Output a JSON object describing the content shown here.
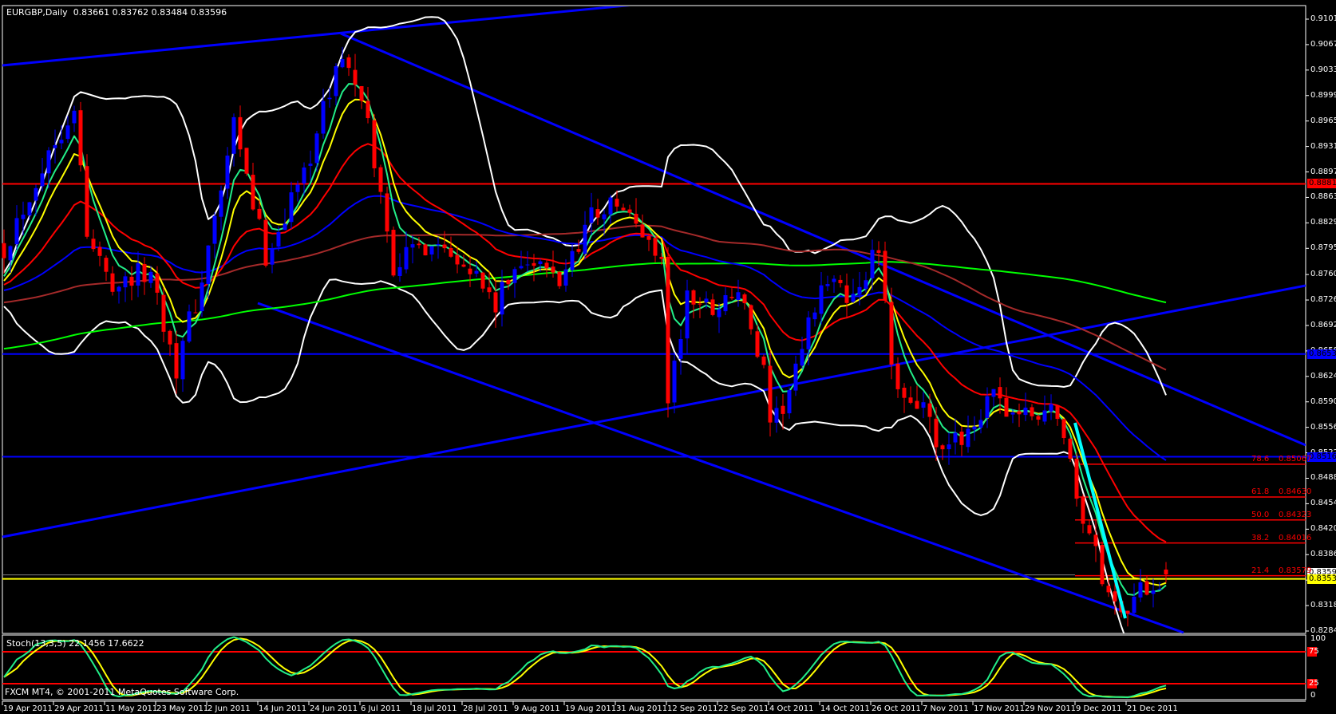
{
  "header": {
    "symbol_timeframe": "EURGBP,Daily",
    "ohlc": "0.83661 0.83762 0.83484 0.83596"
  },
  "indicator": {
    "stoch_label": "Stoch(13,3,5) 22.1456 17.6622",
    "scale_labels": [
      "100",
      "75",
      "25",
      "0"
    ]
  },
  "footer": {
    "copyright": "FXCM MT4, © 2001-2011 MetaQuotes Software Corp."
  },
  "colors": {
    "background": "#000000",
    "bull_candle": "#0000ff",
    "bear_candle": "#ff0000",
    "grid_text": "#ffffff"
  },
  "chart_data": {
    "type": "candlestick",
    "symbol": "EURGBP",
    "timeframe": "Daily",
    "bars": 183,
    "last_bar": {
      "open": 0.83661,
      "high": 0.83762,
      "low": 0.83484,
      "close": 0.83596
    },
    "price_axis": {
      "range": [
        0.8284,
        0.9101
      ],
      "ticks": [
        "0.91010",
        "0.90670",
        "0.90330",
        "0.89990",
        "0.89650",
        "0.89310",
        "0.88970",
        "0.88630",
        "0.88290",
        "0.87950",
        "0.87600",
        "0.87260",
        "0.86920",
        "0.86580",
        "0.86240",
        "0.85900",
        "0.85560",
        "0.85220",
        "0.84880",
        "0.84540",
        "0.84200",
        "0.83860",
        "0.83520",
        "0.83180",
        "0.82840"
      ]
    },
    "date_axis": {
      "bars_per_label": 8,
      "labels": [
        "19 Apr 2011",
        "29 Apr 2011",
        "11 May 2011",
        "23 May 2011",
        "2 Jun 2011",
        "14 Jun 2011",
        "24 Jun 2011",
        "6 Jul 2011",
        "18 Jul 2011",
        "28 Jul 2011",
        "9 Aug 2011",
        "19 Aug 2011",
        "31 Aug 2011",
        "12 Sep 2011",
        "22 Sep 2011",
        "4 Oct 2011",
        "14 Oct 2011",
        "26 Oct 2011",
        "7 Nov 2011",
        "17 Nov 2011",
        "29 Nov 2011",
        "9 Dec 2011",
        "21 Dec 2011"
      ]
    },
    "close_path": [
      [
        0,
        0.8796
      ],
      [
        5,
        0.8887
      ],
      [
        11,
        0.899
      ],
      [
        13,
        0.8807
      ],
      [
        17,
        0.8751
      ],
      [
        23,
        0.8762
      ],
      [
        27,
        0.8637
      ],
      [
        31,
        0.8751
      ],
      [
        36,
        0.8955
      ],
      [
        41,
        0.8785
      ],
      [
        47,
        0.8898
      ],
      [
        53,
        0.9058
      ],
      [
        57,
        0.8955
      ],
      [
        61,
        0.8773
      ],
      [
        67,
        0.8807
      ],
      [
        72,
        0.8785
      ],
      [
        77,
        0.8716
      ],
      [
        81,
        0.8785
      ],
      [
        87,
        0.8751
      ],
      [
        92,
        0.8842
      ],
      [
        96,
        0.8853
      ],
      [
        103,
        0.8785
      ],
      [
        104,
        0.8591
      ],
      [
        107,
        0.8728
      ],
      [
        111,
        0.8716
      ],
      [
        115,
        0.8739
      ],
      [
        119,
        0.8625
      ],
      [
        120,
        0.8546
      ],
      [
        124,
        0.8625
      ],
      [
        128,
        0.8751
      ],
      [
        133,
        0.8728
      ],
      [
        137,
        0.8796
      ],
      [
        139,
        0.8625
      ],
      [
        144,
        0.858
      ],
      [
        147,
        0.8512
      ],
      [
        151,
        0.8557
      ],
      [
        155,
        0.8591
      ],
      [
        160,
        0.8569
      ],
      [
        165,
        0.858
      ],
      [
        168,
        0.8466
      ],
      [
        171,
        0.8385
      ],
      [
        173,
        0.8328
      ],
      [
        176,
        0.8318
      ],
      [
        179,
        0.8345
      ],
      [
        182,
        0.836
      ]
    ],
    "horizontal_levels": [
      {
        "price": 0.88811,
        "label": "0.88811",
        "color": "#ff0000",
        "text_color": "#000000"
      },
      {
        "price": 0.86539,
        "label": "0.86539",
        "color": "#0000ff",
        "text_color": "#000000"
      },
      {
        "price": 0.85167,
        "label": "0.85167",
        "color": "#0000ff",
        "text_color": "#000000"
      },
      {
        "price": 0.83537,
        "label": "0.83537",
        "color": "#ffff00",
        "text_color": "#000000"
      }
    ],
    "current_price_label": "0.83596",
    "fib_levels": [
      {
        "pct": "78.6",
        "price": 0.85067,
        "label": "0.85067"
      },
      {
        "pct": "61.8",
        "price": 0.8463,
        "label": "0.84630"
      },
      {
        "pct": "50.0",
        "price": 0.84323,
        "label": "0.84323"
      },
      {
        "pct": "38.2",
        "price": 0.84016,
        "label": "0.84016"
      },
      {
        "pct": "21.4",
        "price": 0.83579,
        "label": "0.83579"
      }
    ],
    "moving_averages": [
      {
        "period": 5,
        "kind": "ema",
        "color": "#22ee88"
      },
      {
        "period": 8,
        "kind": "ema",
        "color": "#ffff00"
      },
      {
        "period": 21,
        "kind": "ema",
        "color": "#ff0000"
      },
      {
        "period": 55,
        "kind": "ema",
        "color": "#0000ff"
      },
      {
        "period": 100,
        "kind": "sma",
        "color": "#a52a2a"
      },
      {
        "period": 200,
        "kind": "sma",
        "color": "#00ff00"
      }
    ],
    "bollinger": {
      "period": 20,
      "deviation": 2,
      "color": "#ffffff"
    },
    "stochastic": {
      "k": 13,
      "d": 3,
      "slowing": 5,
      "main": 22.1456,
      "signal": 17.6622,
      "levels": [
        75,
        25
      ],
      "range": [
        0,
        100
      ],
      "main_color": "#22ee88",
      "signal_color": "#ffff00",
      "level_color": "#ff0000"
    }
  }
}
